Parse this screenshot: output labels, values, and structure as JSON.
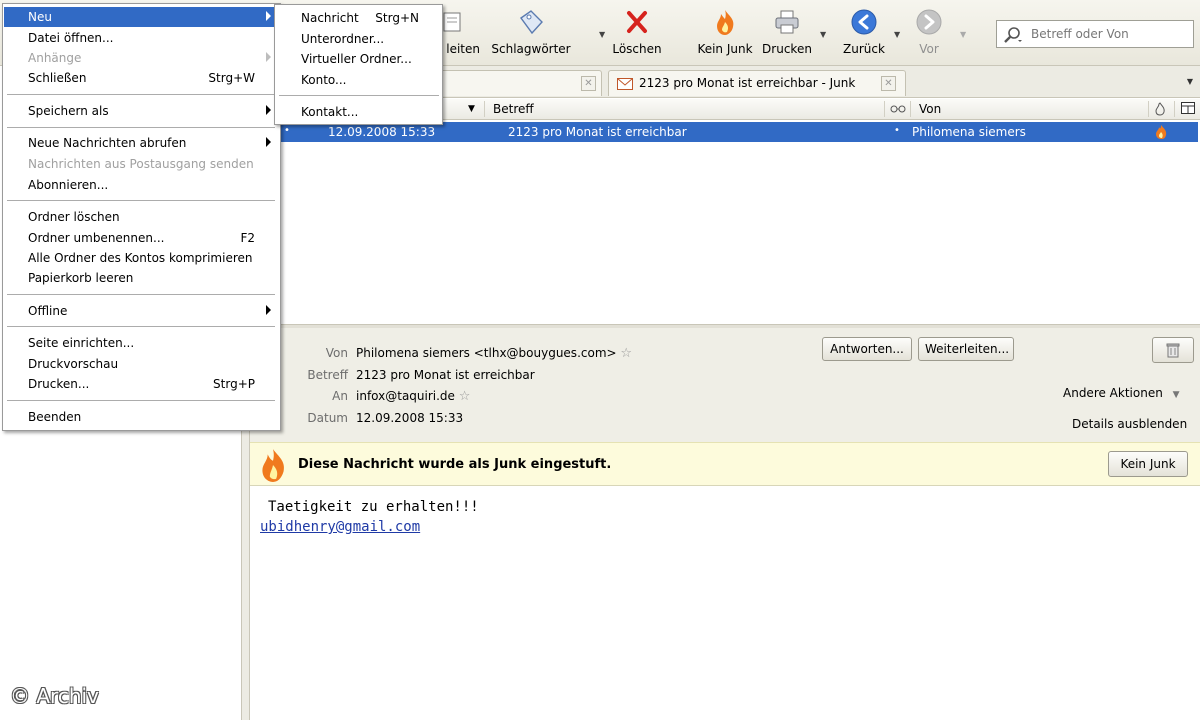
{
  "toolbar": {
    "partial_label": "leiten",
    "tags_label": "Schlagwörter",
    "delete_label": "Löschen",
    "not_junk_label": "Kein Junk",
    "print_label": "Drucken",
    "back_label": "Zurück",
    "forward_label": "Vor",
    "search_placeholder": "Betreff oder Von"
  },
  "tabs": [
    {
      "label": ""
    },
    {
      "label": "2123 pro Monat ist erreichbar - Junk"
    }
  ],
  "thread_columns": {
    "subject": "Betreff",
    "from": "Von"
  },
  "messages": [
    {
      "date": "12.09.2008 15:33",
      "subject": "2123 pro Monat ist erreichbar",
      "from": "Philomena siemers",
      "selected": true
    }
  ],
  "message": {
    "from_label": "Von",
    "from_value": "Philomena siemers  <tlhx@bouygues.com>",
    "subject_label": "Betreff",
    "subject_value": "2123 pro Monat ist erreichbar",
    "to_label": "An",
    "to_value": "infox@taquiri.de",
    "date_label": "Datum",
    "date_value": "12.09.2008 15:33",
    "reply_button": "Antworten...",
    "forward_button": "Weiterleiten...",
    "other_actions": "Andere Aktionen",
    "hide_details": "Details ausblenden",
    "junk_notice": "Diese Nachricht wurde als Junk eingestuft.",
    "not_junk_button": "Kein Junk",
    "body_line1": "Taetigkeit zu erhalten!!!",
    "body_link": "ubidhenry@gmail.com"
  },
  "file_menu": {
    "items": [
      {
        "label": "Neu",
        "shortcut": "",
        "submenu": true,
        "disabled": false,
        "active": true
      },
      {
        "label": "Datei öffnen...",
        "shortcut": "",
        "submenu": false,
        "disabled": false
      },
      {
        "label": "Anhänge",
        "shortcut": "",
        "submenu": true,
        "disabled": true
      },
      {
        "label": "Schließen",
        "shortcut": "Strg+W",
        "submenu": false,
        "disabled": false
      },
      {
        "label": "Speichern als",
        "shortcut": "",
        "submenu": true,
        "disabled": false
      },
      {
        "label": "Neue Nachrichten abrufen",
        "shortcut": "",
        "submenu": true,
        "disabled": false
      },
      {
        "label": "Nachrichten aus Postausgang senden",
        "shortcut": "",
        "submenu": false,
        "disabled": true
      },
      {
        "label": "Abonnieren...",
        "shortcut": "",
        "submenu": false,
        "disabled": false
      },
      {
        "label": "Ordner löschen",
        "shortcut": "",
        "submenu": false,
        "disabled": false
      },
      {
        "label": "Ordner umbenennen...",
        "shortcut": "F2",
        "submenu": false,
        "disabled": false
      },
      {
        "label": "Alle Ordner des Kontos komprimieren",
        "shortcut": "",
        "submenu": false,
        "disabled": false
      },
      {
        "label": "Papierkorb leeren",
        "shortcut": "",
        "submenu": false,
        "disabled": false
      },
      {
        "label": "Offline",
        "shortcut": "",
        "submenu": true,
        "disabled": false
      },
      {
        "label": "Seite einrichten...",
        "shortcut": "",
        "submenu": false,
        "disabled": false
      },
      {
        "label": "Druckvorschau",
        "shortcut": "",
        "submenu": false,
        "disabled": false
      },
      {
        "label": "Drucken...",
        "shortcut": "Strg+P",
        "submenu": false,
        "disabled": false
      },
      {
        "label": "Beenden",
        "shortcut": "",
        "submenu": false,
        "disabled": false
      }
    ]
  },
  "new_submenu": {
    "items": [
      {
        "label": "Nachricht",
        "shortcut": "Strg+N"
      },
      {
        "label": "Unterordner...",
        "shortcut": ""
      },
      {
        "label": "Virtueller Ordner...",
        "shortcut": ""
      },
      {
        "label": "Konto...",
        "shortcut": ""
      },
      {
        "label": "Kontakt...",
        "shortcut": ""
      }
    ]
  },
  "watermark": "© Archiv",
  "colors": {
    "selection": "#316ac5",
    "junk_bar": "#fdfbdc",
    "header_bg": "#efeee6",
    "toolbar_bg": "#ecebe3"
  }
}
